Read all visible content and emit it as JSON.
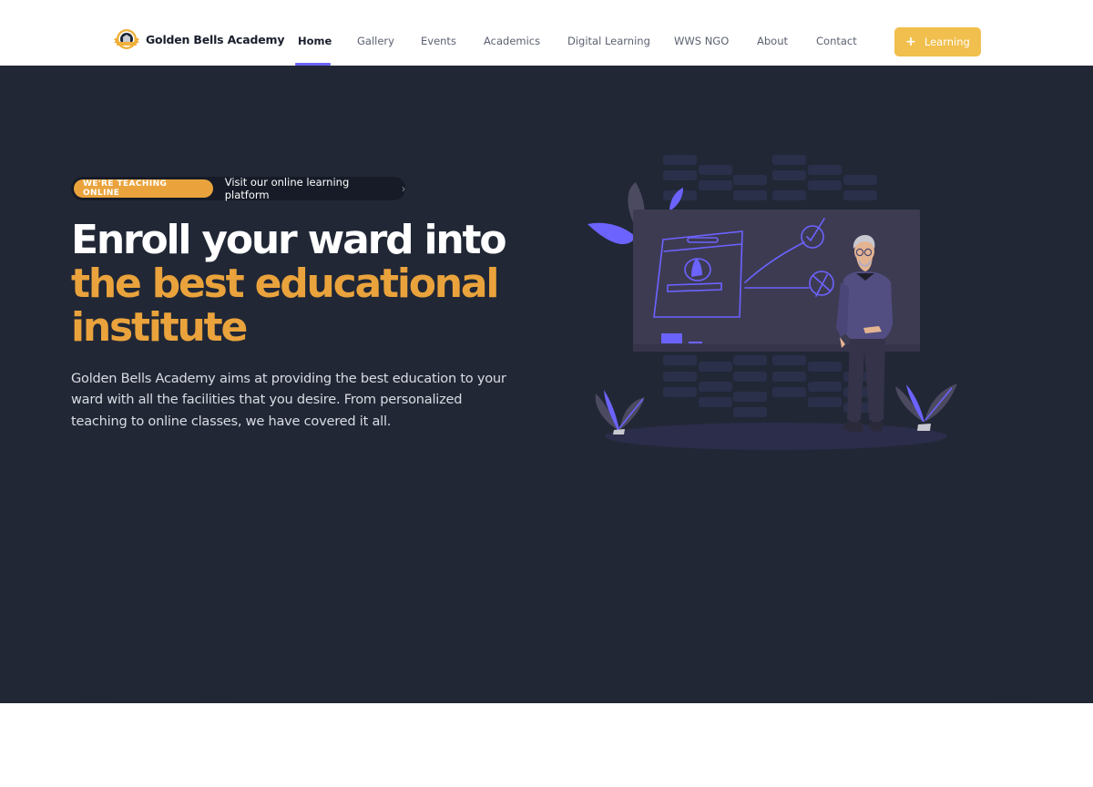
{
  "brand": {
    "name": "Golden Bells Academy",
    "logo_icon": "academy-badge-icon",
    "colors": {
      "accent_gold": "#eaa33c",
      "button_yellow": "#f1bf4d",
      "hero_bg": "#212735",
      "active_indicator": "#6c63ff",
      "illustration_purple": "#6c63ff"
    }
  },
  "nav": {
    "items": [
      {
        "label": "Home",
        "active": true
      },
      {
        "label": "Gallery",
        "active": false
      },
      {
        "label": "Events",
        "active": false
      },
      {
        "label": "Academics",
        "active": false
      },
      {
        "label": "Digital Learning",
        "active": false
      },
      {
        "label": "WWS NGO",
        "active": false
      },
      {
        "label": "About",
        "active": false
      },
      {
        "label": "Contact",
        "active": false
      }
    ],
    "cta": {
      "icon": "plus-icon",
      "icon_glyph": "+",
      "label": "Learning"
    }
  },
  "hero": {
    "announcement": {
      "badge": "WE'RE TEACHING ONLINE",
      "text": "Visit our online learning platform",
      "chevron_glyph": "›"
    },
    "headline": {
      "line1": "Enroll your ward into",
      "line2": "the best educational",
      "line3": "institute"
    },
    "description": "Golden Bells Academy aims at providing the best education to your ward with all the facilities that you desire. From personalized teaching to online classes, we have covered it all.",
    "illustration": "teacher-presenting-at-board-illustration"
  }
}
